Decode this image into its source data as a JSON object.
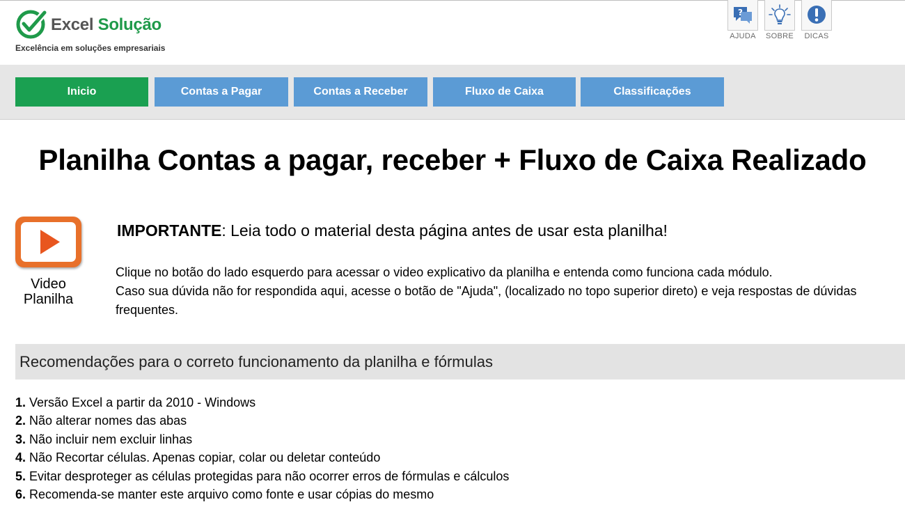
{
  "brand": {
    "name_part1": "Excel",
    "name_part2": "Solução",
    "tagline": "Excelência em soluções empresariais",
    "colors": {
      "green": "#1f9a4a",
      "gray": "#555555"
    }
  },
  "help_icons": [
    {
      "label": "AJUDA",
      "icon": "question-chat-icon"
    },
    {
      "label": "SOBRE",
      "icon": "lightbulb-icon"
    },
    {
      "label": "DICAS",
      "icon": "exclamation-icon"
    }
  ],
  "nav": [
    {
      "label": "Inicio",
      "active": true
    },
    {
      "label": "Contas a Pagar"
    },
    {
      "label": "Contas a Receber"
    },
    {
      "label": "Fluxo de Caixa"
    },
    {
      "label": "Classificações"
    }
  ],
  "nav_colors": {
    "active": "#1aa051",
    "default": "#5b9bd5"
  },
  "title": "Planilha Contas a pagar, receber + Fluxo de Caixa Realizado",
  "video": {
    "label_line1": "Video",
    "label_line2": "Planilha",
    "icon": "play-icon",
    "color": "#e8702a"
  },
  "important": {
    "prefix": "IMPORTANTE",
    "text": ": Leia todo o material desta página antes de usar esta planilha!"
  },
  "intro": {
    "line1": "Clique no botão do lado esquerdo para acessar o video explicativo da planilha e entenda como funciona cada módulo.",
    "line2": "Caso sua dúvida não for respondida aqui, acesse o botão de \"Ajuda\", (localizado no topo superior direto) e veja respostas de dúvidas frequentes."
  },
  "recommendations": {
    "header": "Recomendações para o correto funcionamento da planilha e fórmulas",
    "items": [
      {
        "num": "1.",
        "text": " Versão Excel a partir da 2010 - Windows"
      },
      {
        "num": "2.",
        "text": " Não alterar nomes das abas"
      },
      {
        "num": "3.",
        "text": " Não incluir nem excluir linhas"
      },
      {
        "num": "4.",
        "text": " Não Recortar células. Apenas copiar, colar ou deletar conteúdo"
      },
      {
        "num": "5.",
        "text": " Evitar desproteger as células protegidas para não ocorrer erros de fórmulas e cálculos"
      },
      {
        "num": "6.",
        "text": " Recomenda-se manter este arquivo como fonte e usar cópias do mesmo"
      }
    ]
  }
}
